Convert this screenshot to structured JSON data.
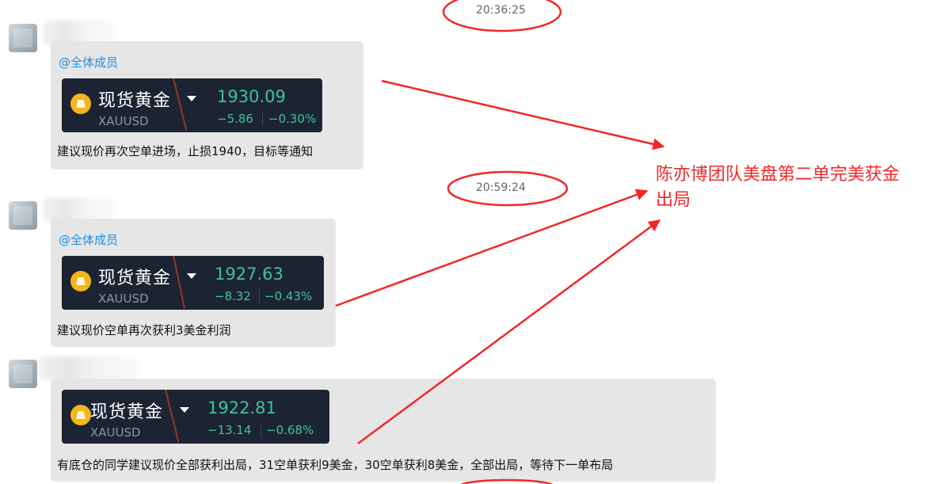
{
  "timestamps": [
    "20:36:25",
    "20:59:24"
  ],
  "messages": [
    {
      "mention": "@全体成员",
      "quote": {
        "name": "现货黄金",
        "symbol": "XAUUSD",
        "price": "1930.09",
        "change": "−5.86",
        "percent": "−0.30%"
      },
      "text": "建议现价再次空单进场，止损1940，目标等通知"
    },
    {
      "mention": "@全体成员",
      "quote": {
        "name": "现货黄金",
        "symbol": "XAUUSD",
        "price": "1927.63",
        "change": "−8.32",
        "percent": "−0.43%"
      },
      "text": "建议现价空单再次获利3美金利润"
    },
    {
      "mention": "",
      "quote": {
        "name": "现货黄金",
        "symbol": "XAUUSD",
        "price": "1922.81",
        "change": "−13.14",
        "percent": "−0.68%"
      },
      "text": "有底仓的同学建议现价全部获利出局，31空单获利9美金，30空单获利8美金，全部出局，等待下一单布局"
    }
  ],
  "annotation": "陈亦博团队美盘第二单完美获金出局",
  "colors": {
    "annotation": "#f0282b",
    "bubble": "#e6e6e6",
    "mention": "#1e8fe0",
    "quote_background": "#1c2433",
    "quote_green": "#41c29a",
    "coin": "#f2b61d"
  },
  "icons": [
    "gold-coin-icon",
    "dropdown-caret-icon"
  ]
}
